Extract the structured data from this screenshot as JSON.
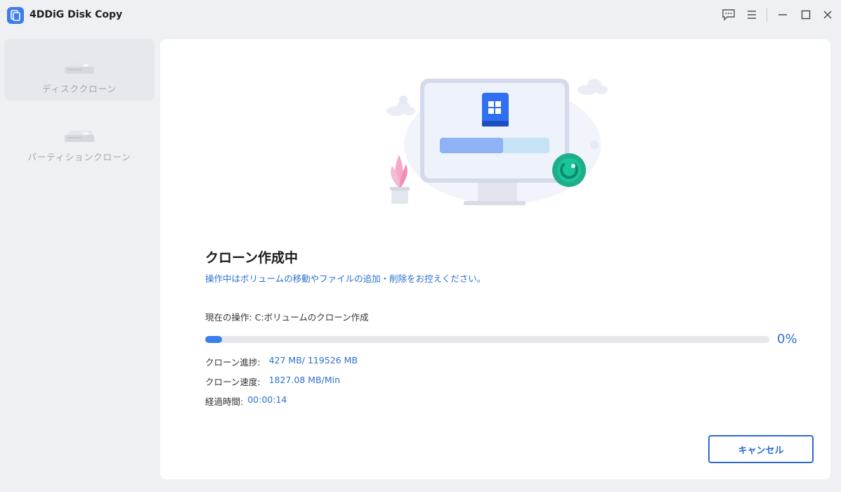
{
  "app": {
    "title": "4DDiG Disk Copy"
  },
  "window_controls": [
    "feedback-icon",
    "menu-icon",
    "minimize-icon",
    "maximize-icon",
    "close-icon"
  ],
  "sidebar": {
    "items": [
      {
        "label": "ディスククローン",
        "icon": "disk-icon",
        "active": true
      },
      {
        "label": "パーティションクローン",
        "icon": "partition-disk-icon",
        "active": false
      }
    ]
  },
  "main": {
    "heading": "クローン作成中",
    "subtext": "操作中はボリュームの移動やファイルの追加・削除をお控えください。",
    "operation_label": "現在の操作:",
    "operation_value": "C:ボリュームのクローン作成",
    "progress_percent_value": 3,
    "progress_percent_text": "0%",
    "stats": {
      "progress_label": "クローン進捗:",
      "progress_value": "427 MB/ 119526 MB",
      "speed_label": "クローン速度:",
      "speed_value": "1827.08 MB/Min",
      "elapsed_label": "経過時間:",
      "elapsed_value": "00:00:14"
    },
    "cancel_label": "キャンセル"
  },
  "colors": {
    "accent": "#2b6fd0",
    "progress": "#3b7fee",
    "success": "#1fae8a"
  }
}
